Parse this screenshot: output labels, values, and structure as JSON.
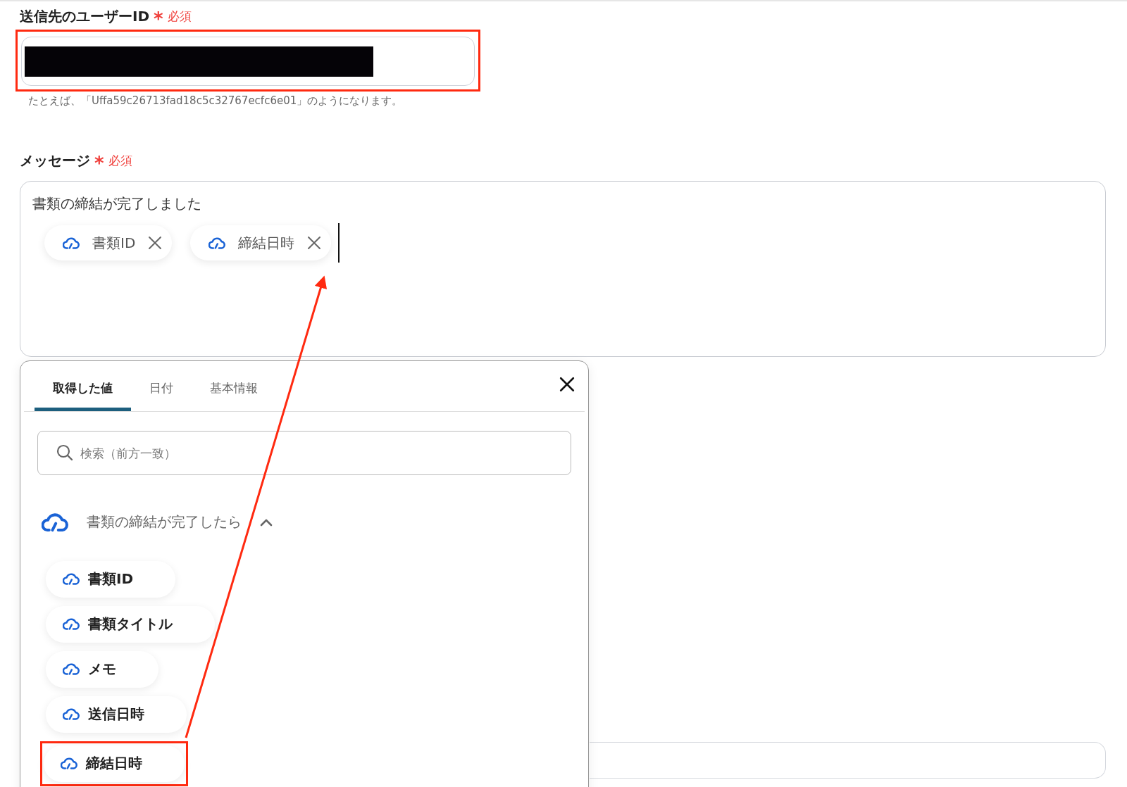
{
  "recipient": {
    "label": "送信先のユーザーID",
    "required_mark": "*",
    "required_text": "必須",
    "value_redacted": true,
    "highlighted": true,
    "hint": "たとえば、「Uffa59c26713fad18c5c32767ecfc6e01」のようになります。"
  },
  "message": {
    "label": "メッセージ",
    "required_mark": "*",
    "required_text": "必須",
    "text": "書類の締結が完了しました",
    "tokens": [
      {
        "label": "書類ID"
      },
      {
        "label": "締結日時"
      }
    ]
  },
  "picker": {
    "tabs": [
      {
        "label": "取得した値",
        "selected": true
      },
      {
        "label": "日付",
        "selected": false
      },
      {
        "label": "基本情報",
        "selected": false
      }
    ],
    "search": {
      "placeholder": "検索（前方一致）"
    },
    "group": {
      "title": "書類の締結が完了したら",
      "expanded": true,
      "items": [
        {
          "label": "書類ID",
          "highlighted": false
        },
        {
          "label": "書類タイトル",
          "highlighted": false
        },
        {
          "label": "メモ",
          "highlighted": false
        },
        {
          "label": "送信日時",
          "highlighted": false
        },
        {
          "label": "締結日時",
          "highlighted": true
        }
      ]
    }
  },
  "annotation": {
    "kind": "arrow"
  }
}
